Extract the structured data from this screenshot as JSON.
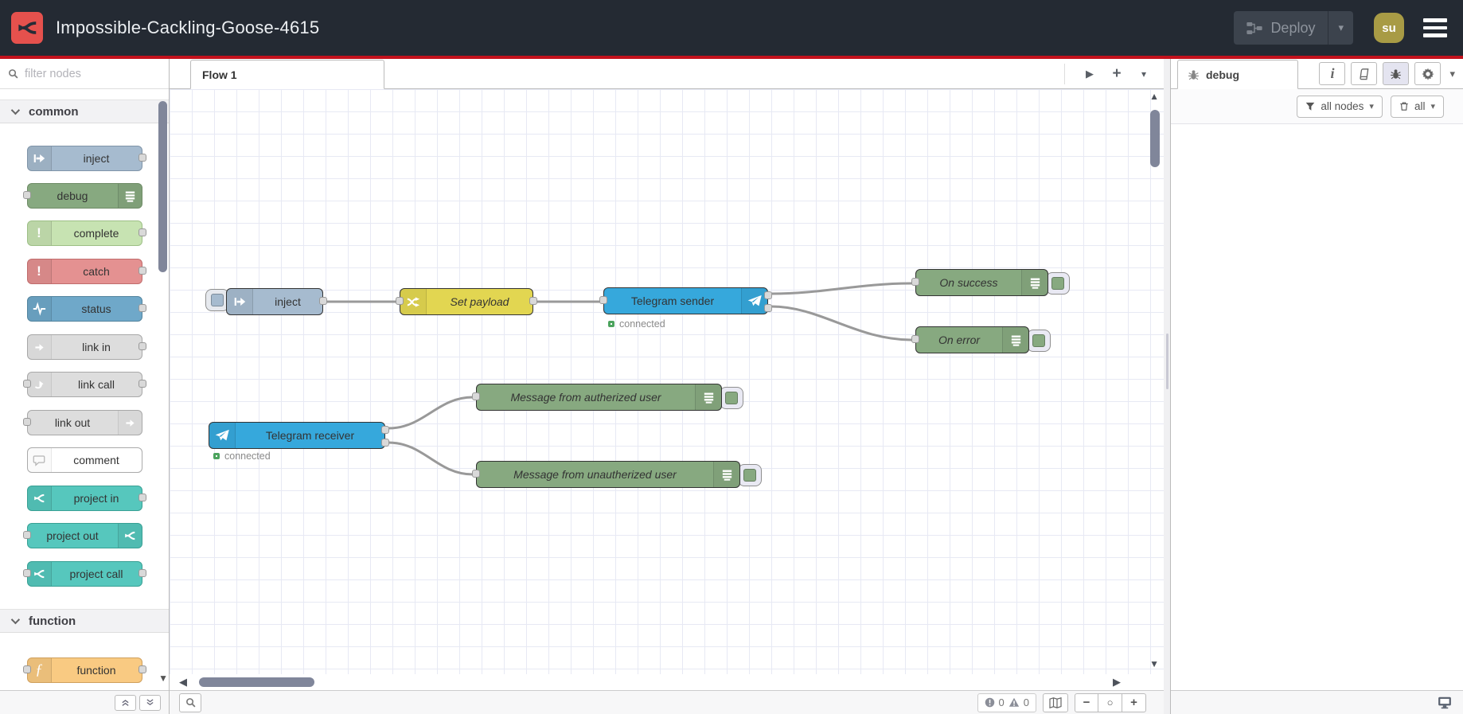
{
  "header": {
    "title": "Impossible-Cackling-Goose-4615",
    "deploy_label": "Deploy",
    "user_initials": "su"
  },
  "palette": {
    "filter_placeholder": "filter nodes",
    "categories": [
      {
        "label": "common",
        "items": [
          "inject",
          "debug",
          "complete",
          "catch",
          "status",
          "link in",
          "link call",
          "link out",
          "comment",
          "project in",
          "project out",
          "project call"
        ]
      },
      {
        "label": "function",
        "items": [
          "function"
        ]
      }
    ]
  },
  "workspace": {
    "tab_label": "Flow 1"
  },
  "flow": {
    "nodes": {
      "inject": {
        "label": "inject"
      },
      "set_payload": {
        "label": "Set payload"
      },
      "telegram_sender": {
        "label": "Telegram sender",
        "status": "connected"
      },
      "on_success": {
        "label": "On success"
      },
      "on_error": {
        "label": "On error"
      },
      "telegram_receiver": {
        "label": "Telegram receiver",
        "status": "connected"
      },
      "msg_authorized": {
        "label": "Message from autherized user"
      },
      "msg_unauthorized": {
        "label": "Message from unautherized user"
      }
    }
  },
  "sidebar": {
    "tab_label": "debug",
    "filter_all_nodes": "all nodes",
    "clear_all": "all"
  },
  "statusbar": {
    "error_count": "0",
    "warning_count": "0"
  },
  "icons": {
    "caret_down": "▾",
    "flow_list": "▶",
    "add_flow": "+",
    "scroll_left": "◀",
    "scroll_right": "▶",
    "scroll_up": "▲",
    "scroll_down": "▼",
    "zoom_out": "−",
    "zoom_reset": "○",
    "zoom_in": "+",
    "exclamation": "!",
    "function_glyph": "ƒ"
  },
  "colors": {
    "header_bg": "#242a33",
    "brand_red": "#e5514d",
    "header_rule": "#c3111c",
    "avatar_bg": "#a89b45",
    "node_inject": "#a6bbcf",
    "node_debug": "#87a980",
    "node_complete": "#c7e3b2",
    "node_catch": "#e49191",
    "node_status": "#6fa8c9",
    "node_link": "#dddddd",
    "node_comment": "#ffffff",
    "node_project": "#56c7bd",
    "node_function": "#f9ca82",
    "node_change": "#e2d651",
    "node_telegram": "#36a8dc",
    "status_connected": "#4ca35e",
    "wire": "#999999",
    "active_tool_bg": "#e4e4f0"
  }
}
